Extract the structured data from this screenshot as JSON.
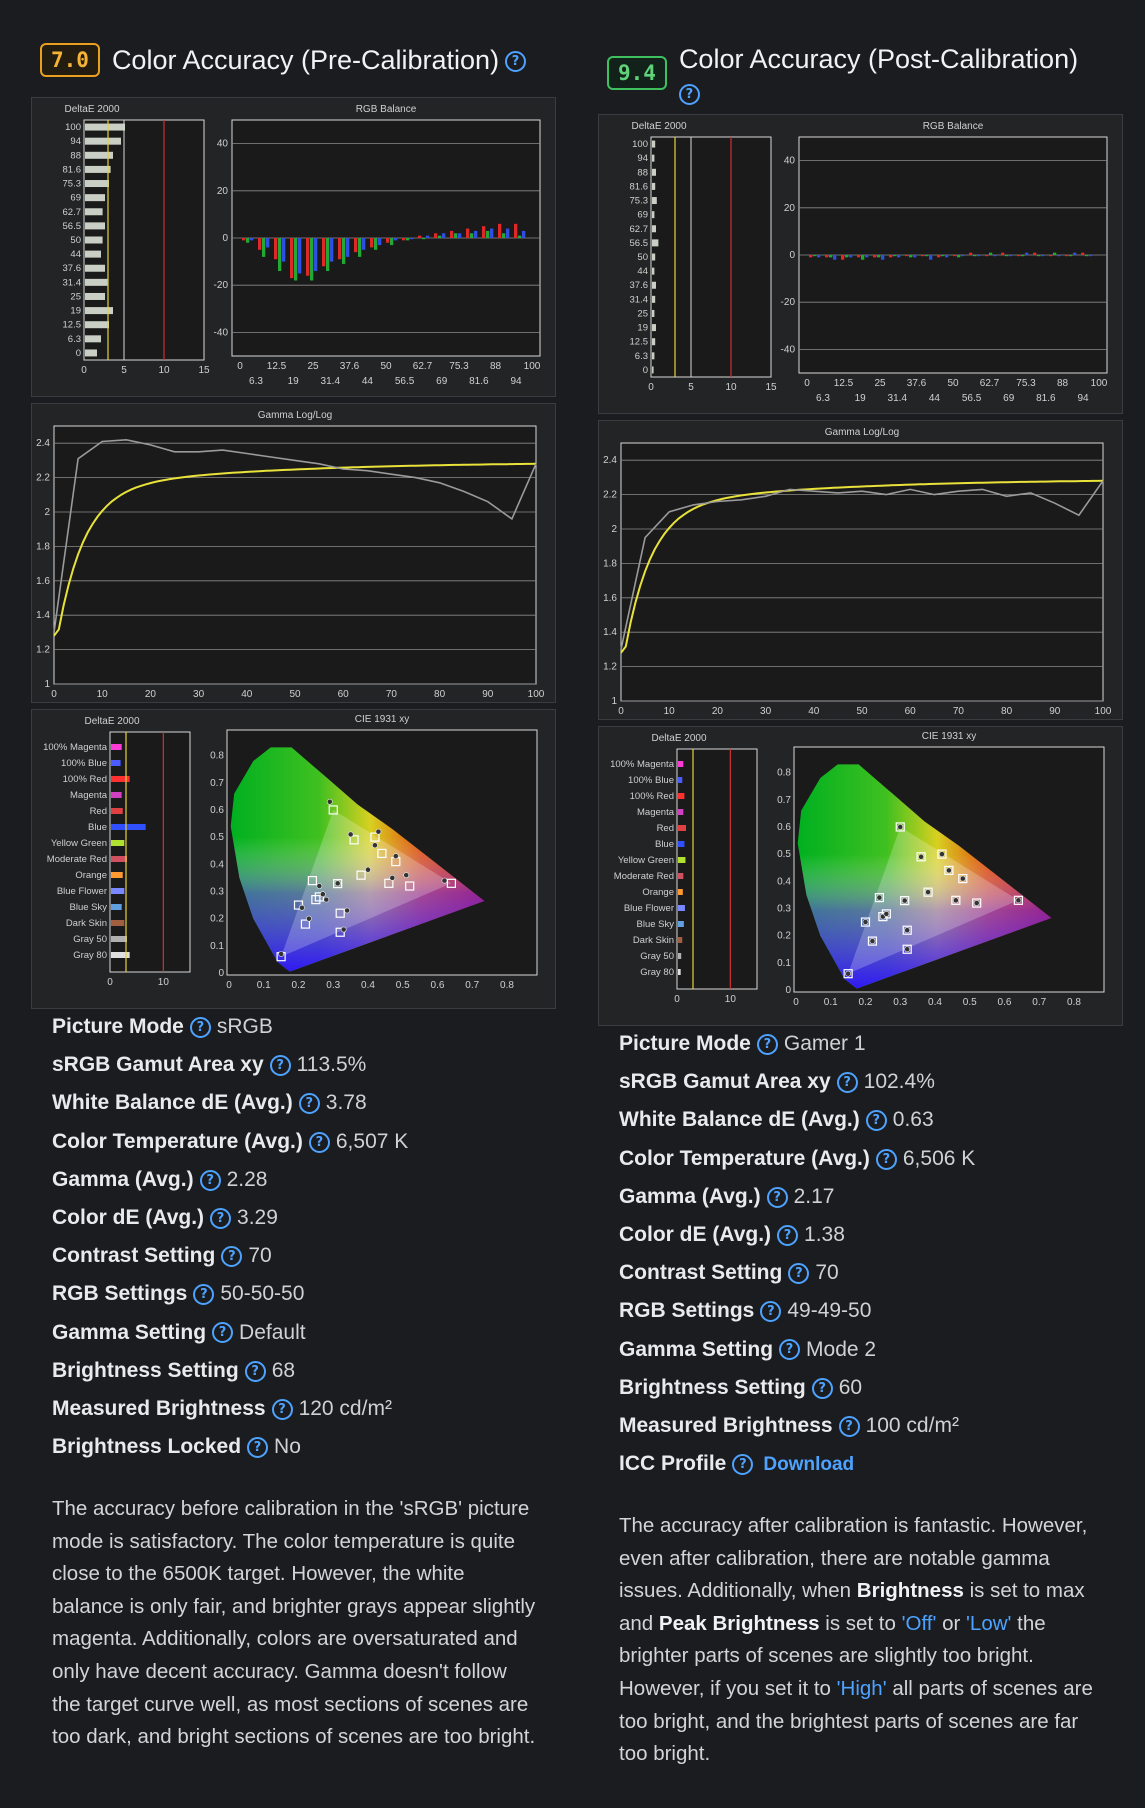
{
  "columns": [
    {
      "badge_score": "7.0",
      "badge_color": "#f5b335",
      "title": "Color Accuracy (Pre-Calibration)",
      "deltae_gray": {
        "title": "DeltaE 2000",
        "levels": [
          "100",
          "94",
          "88",
          "81.6",
          "75.3",
          "69",
          "62.7",
          "56.5",
          "50",
          "44",
          "37.6",
          "31.4",
          "25",
          "19",
          "12.5",
          "6.3",
          "0"
        ],
        "values": [
          5.0,
          4.5,
          3.5,
          3.2,
          3.0,
          2.5,
          2.2,
          2.5,
          2.2,
          2.0,
          2.5,
          2.8,
          2.5,
          3.5,
          3.0,
          2.0,
          1.5
        ],
        "xticks": [
          "0",
          "5",
          "10",
          "15"
        ],
        "yellow_line": 3,
        "red_line": 10,
        "xmax": 15
      },
      "rgb_balance": {
        "title": "RGB Balance",
        "yticks": [
          "40",
          "20",
          "0",
          "-20",
          "-40"
        ],
        "xticks_top": [
          "0",
          "12.5",
          "25",
          "37.6",
          "50",
          "62.7",
          "75.3",
          "88",
          "100"
        ],
        "xticks_bottom": [
          "6.3",
          "19",
          "31.4",
          "44",
          "56.5",
          "69",
          "81.6",
          "94"
        ],
        "red": [
          -1,
          -5,
          -9,
          -17,
          -16,
          -12,
          -9,
          -6,
          -4,
          -2,
          -1,
          1,
          2,
          3,
          4,
          5,
          6,
          6
        ],
        "green": [
          -2,
          -8,
          -14,
          -18,
          -18,
          -14,
          -11,
          -8,
          -5,
          -3,
          -1,
          0,
          1,
          2,
          2,
          3,
          2,
          1
        ],
        "blue": [
          -1,
          -4,
          -10,
          -15,
          -14,
          -10,
          -8,
          -5,
          -3,
          -1,
          0,
          1,
          2,
          2,
          3,
          4,
          4,
          3
        ]
      },
      "gamma": {
        "title": "Gamma Log/Log",
        "yticks": [
          "2.4",
          "2.2",
          "2",
          "1.8",
          "1.6",
          "1.4",
          "1.2",
          "1"
        ],
        "xticks": [
          "0",
          "10",
          "20",
          "30",
          "40",
          "50",
          "60",
          "70",
          "80",
          "90",
          "100"
        ],
        "x": [
          0,
          5,
          10,
          15,
          20,
          25,
          30,
          35,
          40,
          45,
          50,
          55,
          60,
          65,
          70,
          75,
          80,
          85,
          90,
          95,
          100
        ],
        "measured": [
          1.3,
          2.31,
          2.41,
          2.42,
          2.39,
          2.35,
          2.35,
          2.36,
          2.34,
          2.32,
          2.3,
          2.28,
          2.25,
          2.24,
          2.22,
          2.2,
          2.17,
          2.12,
          2.06,
          1.96,
          2.28
        ]
      },
      "deltae_color": {
        "title": "DeltaE 2000",
        "labels": [
          "100% Magenta",
          "100% Blue",
          "100% Red",
          "Magenta",
          "Red",
          "Blue",
          "Yellow Green",
          "Moderate Red",
          "Orange",
          "Blue Flower",
          "Blue Sky",
          "Dark Skin",
          "Gray 50",
          "Gray 80"
        ],
        "values": [
          2.0,
          1.8,
          3.5,
          2.0,
          2.2,
          6.5,
          2.5,
          3.0,
          2.2,
          2.5,
          2.0,
          2.5,
          3.0,
          3.5
        ],
        "xticks": [
          "0",
          "10"
        ],
        "xmax": 15
      },
      "cie": {
        "title": "CIE 1931 xy",
        "xticks": [
          "0",
          "0.1",
          "0.2",
          "0.3",
          "0.4",
          "0.5",
          "0.6",
          "0.7",
          "0.8"
        ],
        "yticks": [
          "0.8",
          "0.7",
          "0.6",
          "0.5",
          "0.4",
          "0.3",
          "0.2",
          "0.1",
          "0"
        ],
        "targets": [
          [
            0.64,
            0.33
          ],
          [
            0.3,
            0.6
          ],
          [
            0.15,
            0.06
          ],
          [
            0.3127,
            0.329
          ],
          [
            0.38,
            0.36
          ],
          [
            0.46,
            0.33
          ],
          [
            0.52,
            0.32
          ],
          [
            0.42,
            0.5
          ],
          [
            0.25,
            0.27
          ],
          [
            0.24,
            0.34
          ],
          [
            0.2,
            0.25
          ],
          [
            0.22,
            0.18
          ],
          [
            0.32,
            0.15
          ],
          [
            0.26,
            0.28
          ],
          [
            0.36,
            0.49
          ],
          [
            0.44,
            0.44
          ],
          [
            0.48,
            0.41
          ],
          [
            0.32,
            0.22
          ]
        ],
        "measured": [
          [
            0.62,
            0.34
          ],
          [
            0.29,
            0.63
          ],
          [
            0.15,
            0.07
          ],
          [
            0.3127,
            0.33
          ],
          [
            0.4,
            0.38
          ],
          [
            0.47,
            0.35
          ],
          [
            0.51,
            0.36
          ],
          [
            0.43,
            0.52
          ],
          [
            0.27,
            0.29
          ],
          [
            0.26,
            0.32
          ],
          [
            0.21,
            0.24
          ],
          [
            0.23,
            0.2
          ],
          [
            0.33,
            0.16
          ],
          [
            0.28,
            0.27
          ],
          [
            0.35,
            0.51
          ],
          [
            0.42,
            0.47
          ],
          [
            0.48,
            0.43
          ],
          [
            0.34,
            0.23
          ]
        ]
      },
      "metrics": [
        {
          "label": "Picture Mode",
          "value": "sRGB"
        },
        {
          "label": "sRGB Gamut Area xy",
          "value": "113.5%"
        },
        {
          "label": "White Balance dE (Avg.)",
          "value": "3.78"
        },
        {
          "label": "Color Temperature (Avg.)",
          "value": "6,507 K"
        },
        {
          "label": "Gamma (Avg.)",
          "value": "2.28"
        },
        {
          "label": "Color dE (Avg.)",
          "value": "3.29"
        },
        {
          "label": "Contrast Setting",
          "value": "70"
        },
        {
          "label": "RGB Settings",
          "value": "50-50-50"
        },
        {
          "label": "Gamma Setting",
          "value": "Default"
        },
        {
          "label": "Brightness Setting",
          "value": "68"
        },
        {
          "label": "Measured Brightness",
          "value": "120 cd/m²"
        },
        {
          "label": "Brightness Locked",
          "value": "No"
        }
      ],
      "paragraph": "The accuracy before calibration in the 'sRGB' picture mode is satisfactory. The color temperature is quite close to the 6500K target. However, the white balance is only fair, and brighter grays appear slightly magenta. Additionally, colors are oversaturated and only have decent accuracy. Gamma doesn't follow the target curve well, as most sections of scenes are too dark, and bright sections of scenes are too bright."
    },
    {
      "badge_score": "9.4",
      "badge_color": "#5fd27a",
      "title": "Color Accuracy (Post-Calibration)",
      "deltae_gray": {
        "title": "DeltaE 2000",
        "levels": [
          "100",
          "94",
          "88",
          "81.6",
          "75.3",
          "69",
          "62.7",
          "56.5",
          "50",
          "44",
          "37.6",
          "31.4",
          "25",
          "19",
          "12.5",
          "6.3",
          "0"
        ],
        "values": [
          0.4,
          0.3,
          0.5,
          0.4,
          0.6,
          0.3,
          0.5,
          0.8,
          0.4,
          0.3,
          0.5,
          0.4,
          0.3,
          0.5,
          0.4,
          0.3,
          0.2
        ],
        "xticks": [
          "0",
          "5",
          "10",
          "15"
        ],
        "yellow_line": 3,
        "red_line": 10,
        "xmax": 15
      },
      "rgb_balance": {
        "title": "RGB Balance",
        "yticks": [
          "40",
          "20",
          "0",
          "-20",
          "-40"
        ],
        "xticks_top": [
          "0",
          "12.5",
          "25",
          "37.6",
          "50",
          "62.7",
          "75.3",
          "88",
          "100"
        ],
        "xticks_bottom": [
          "6.3",
          "19",
          "31.4",
          "44",
          "56.5",
          "69",
          "81.6",
          "94"
        ],
        "red": [
          -1,
          -1,
          -2,
          -1,
          -1,
          -1,
          0,
          0,
          -1,
          0,
          1,
          0,
          1,
          0,
          1,
          0,
          0,
          1
        ],
        "green": [
          0,
          -1,
          -1,
          -2,
          -1,
          0,
          -1,
          0,
          0,
          -1,
          0,
          1,
          0,
          0,
          0,
          1,
          0,
          0
        ],
        "blue": [
          -1,
          -2,
          -1,
          -1,
          -2,
          -1,
          -1,
          -2,
          -1,
          0,
          0,
          0,
          0,
          1,
          0,
          0,
          1,
          0
        ]
      },
      "gamma": {
        "title": "Gamma Log/Log",
        "yticks": [
          "2.4",
          "2.2",
          "2",
          "1.8",
          "1.6",
          "1.4",
          "1.2",
          "1"
        ],
        "xticks": [
          "0",
          "10",
          "20",
          "30",
          "40",
          "50",
          "60",
          "70",
          "80",
          "90",
          "100"
        ],
        "x": [
          0,
          5,
          10,
          15,
          20,
          25,
          30,
          35,
          40,
          45,
          50,
          55,
          60,
          65,
          70,
          75,
          80,
          85,
          90,
          95,
          100
        ],
        "measured": [
          1.3,
          1.95,
          2.1,
          2.14,
          2.16,
          2.17,
          2.19,
          2.23,
          2.22,
          2.21,
          2.22,
          2.2,
          2.23,
          2.2,
          2.22,
          2.23,
          2.19,
          2.21,
          2.15,
          2.08,
          2.28
        ]
      },
      "deltae_color": {
        "title": "DeltaE 2000",
        "labels": [
          "100% Magenta",
          "100% Blue",
          "100% Red",
          "Magenta",
          "Red",
          "Blue",
          "Yellow Green",
          "Moderate Red",
          "Orange",
          "Blue Flower",
          "Blue Sky",
          "Dark Skin",
          "Gray 50",
          "Gray 80"
        ],
        "values": [
          1.0,
          0.8,
          1.2,
          1.0,
          1.5,
          1.2,
          1.4,
          1.0,
          0.9,
          1.3,
          1.1,
          0.8,
          0.6,
          0.5
        ],
        "xticks": [
          "0",
          "10"
        ],
        "xmax": 15
      },
      "cie": {
        "title": "CIE 1931 xy",
        "xticks": [
          "0",
          "0.1",
          "0.2",
          "0.3",
          "0.4",
          "0.5",
          "0.6",
          "0.7",
          "0.8"
        ],
        "yticks": [
          "0.8",
          "0.7",
          "0.6",
          "0.5",
          "0.4",
          "0.3",
          "0.2",
          "0.1",
          "0"
        ],
        "targets": [
          [
            0.64,
            0.33
          ],
          [
            0.3,
            0.6
          ],
          [
            0.15,
            0.06
          ],
          [
            0.3127,
            0.329
          ],
          [
            0.38,
            0.36
          ],
          [
            0.46,
            0.33
          ],
          [
            0.52,
            0.32
          ],
          [
            0.42,
            0.5
          ],
          [
            0.25,
            0.27
          ],
          [
            0.24,
            0.34
          ],
          [
            0.2,
            0.25
          ],
          [
            0.22,
            0.18
          ],
          [
            0.32,
            0.15
          ],
          [
            0.26,
            0.28
          ],
          [
            0.36,
            0.49
          ],
          [
            0.44,
            0.44
          ],
          [
            0.48,
            0.41
          ],
          [
            0.32,
            0.22
          ]
        ],
        "measured": [
          [
            0.64,
            0.33
          ],
          [
            0.3,
            0.6
          ],
          [
            0.15,
            0.06
          ],
          [
            0.3127,
            0.329
          ],
          [
            0.38,
            0.36
          ],
          [
            0.46,
            0.33
          ],
          [
            0.52,
            0.32
          ],
          [
            0.42,
            0.5
          ],
          [
            0.25,
            0.27
          ],
          [
            0.24,
            0.34
          ],
          [
            0.2,
            0.25
          ],
          [
            0.22,
            0.18
          ],
          [
            0.32,
            0.15
          ],
          [
            0.26,
            0.28
          ],
          [
            0.36,
            0.49
          ],
          [
            0.44,
            0.44
          ],
          [
            0.48,
            0.41
          ],
          [
            0.32,
            0.22
          ]
        ]
      },
      "metrics": [
        {
          "label": "Picture Mode",
          "value": "Gamer 1"
        },
        {
          "label": "sRGB Gamut Area xy",
          "value": "102.4%"
        },
        {
          "label": "White Balance dE (Avg.)",
          "value": "0.63"
        },
        {
          "label": "Color Temperature (Avg.)",
          "value": "6,506 K"
        },
        {
          "label": "Gamma (Avg.)",
          "value": "2.17"
        },
        {
          "label": "Color dE (Avg.)",
          "value": "1.38"
        },
        {
          "label": "Contrast Setting",
          "value": "70"
        },
        {
          "label": "RGB Settings",
          "value": "49-49-50"
        },
        {
          "label": "Gamma Setting",
          "value": "Mode 2"
        },
        {
          "label": "Brightness Setting",
          "value": "60"
        },
        {
          "label": "Measured Brightness",
          "value": "100 cd/m²"
        },
        {
          "label": "ICC Profile",
          "value": "",
          "link": "Download"
        }
      ],
      "paragraph_parts": [
        {
          "t": "The accuracy after calibration is fantastic. However, even after calibration, there are notable gamma issues. Additionally, when ",
          "s": ""
        },
        {
          "t": "Brightness",
          "s": "b"
        },
        {
          "t": " is set to max and ",
          "s": ""
        },
        {
          "t": "Peak Brightness",
          "s": "b"
        },
        {
          "t": " is set to ",
          "s": ""
        },
        {
          "t": "'Off'",
          "s": "lk"
        },
        {
          "t": " or ",
          "s": ""
        },
        {
          "t": "'Low'",
          "s": "lk"
        },
        {
          "t": " the brighter parts of scenes are slightly too bright. However, if you set it to ",
          "s": ""
        },
        {
          "t": "'High'",
          "s": "lk"
        },
        {
          "t": " all parts of scenes are too bright, and the brightest parts of scenes are far too bright.",
          "s": ""
        }
      ]
    }
  ],
  "chart_data": [
    {
      "type": "bar",
      "title": "DeltaE 2000",
      "categories": [
        "100",
        "94",
        "88",
        "81.6",
        "75.3",
        "69",
        "62.7",
        "56.5",
        "50",
        "44",
        "37.6",
        "31.4",
        "25",
        "19",
        "12.5",
        "6.3",
        "0"
      ],
      "values": [
        5.0,
        4.5,
        3.5,
        3.2,
        3.0,
        2.5,
        2.2,
        2.5,
        2.2,
        2.0,
        2.5,
        2.8,
        2.5,
        3.5,
        3.0,
        2.0,
        1.5
      ],
      "xlim": [
        0,
        15
      ]
    },
    {
      "type": "bar",
      "title": "RGB Balance",
      "ylim": [
        -50,
        50
      ]
    },
    {
      "type": "line",
      "title": "Gamma Log/Log",
      "xlim": [
        0,
        100
      ],
      "ylim": [
        1,
        2.5
      ]
    },
    {
      "type": "bar",
      "title": "DeltaE 2000",
      "xlim": [
        0,
        15
      ]
    },
    {
      "type": "scatter",
      "title": "CIE 1931 xy",
      "xlim": [
        0,
        0.8
      ],
      "ylim": [
        0,
        0.85
      ]
    },
    {
      "type": "bar",
      "title": "DeltaE 2000",
      "xlim": [
        0,
        15
      ]
    },
    {
      "type": "bar",
      "title": "RGB Balance",
      "ylim": [
        -50,
        50
      ]
    },
    {
      "type": "line",
      "title": "Gamma Log/Log",
      "xlim": [
        0,
        100
      ],
      "ylim": [
        1,
        2.5
      ]
    },
    {
      "type": "bar",
      "title": "DeltaE 2000",
      "xlim": [
        0,
        15
      ]
    },
    {
      "type": "scatter",
      "title": "CIE 1931 xy",
      "xlim": [
        0,
        0.8
      ],
      "ylim": [
        0,
        0.85
      ]
    }
  ]
}
